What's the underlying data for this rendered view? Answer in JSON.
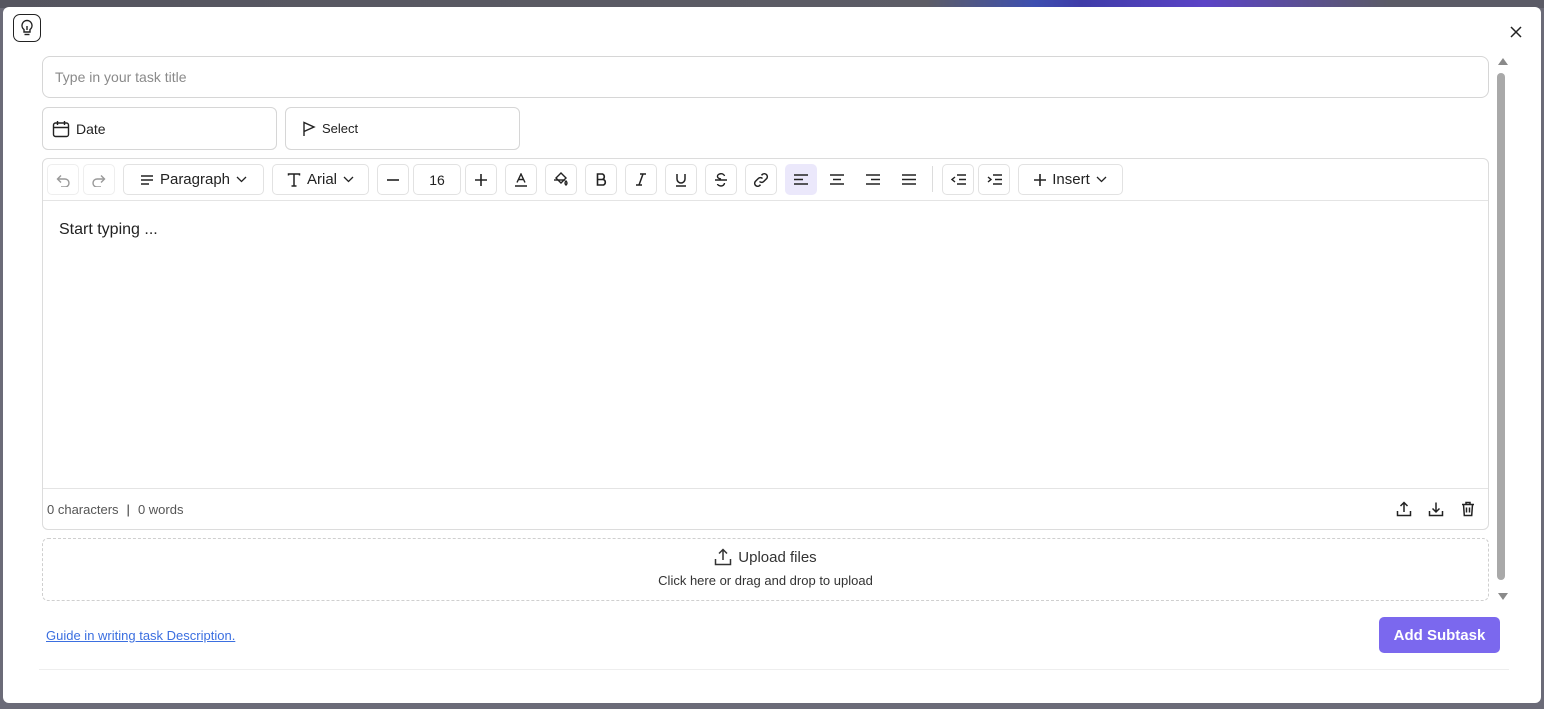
{
  "dialog": {
    "title_input": {
      "placeholder": "Type in your task title",
      "value": ""
    },
    "date_button_label": "Date",
    "priority_select_label": "Select"
  },
  "editor": {
    "toolbar": {
      "block_format": "Paragraph",
      "font_family": "Arial",
      "font_size": "16",
      "insert_label": "Insert",
      "icons": [
        "undo-icon",
        "redo-icon",
        "paragraph-icon",
        "font-icon",
        "decrease-font-icon",
        "increase-font-icon",
        "text-color-icon",
        "highlight-color-icon",
        "bold-icon",
        "italic-icon",
        "underline-icon",
        "strikethrough-icon",
        "link-icon",
        "align-left-icon",
        "align-center-icon",
        "align-right-icon",
        "align-justify-icon",
        "outdent-icon",
        "indent-icon",
        "plus-icon"
      ],
      "active_alignment": "left"
    },
    "placeholder_text": "Start typing ...",
    "footer": {
      "characters": "0 characters",
      "separator": "|",
      "words": "0 words",
      "icons": [
        "upload-icon",
        "download-icon",
        "trash-icon"
      ]
    }
  },
  "upload": {
    "title": "Upload files",
    "subtitle": "Click here or drag and drop to upload"
  },
  "footer": {
    "guide_link": "Guide in writing task Description.",
    "add_button": "Add Subtask"
  },
  "colors": {
    "accent": "#7b68ee",
    "link": "#3b6fe0",
    "active_tool_bg": "#ebe8fb"
  }
}
